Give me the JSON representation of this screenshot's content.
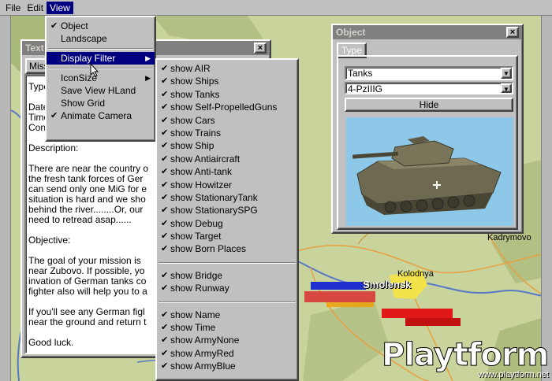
{
  "menubar": {
    "items": [
      "File",
      "Edit",
      "View"
    ]
  },
  "view_menu": {
    "items": [
      {
        "label": "Object",
        "checked": true
      },
      {
        "label": "Landscape",
        "checked": false
      },
      {
        "label": "Display Filter",
        "submenu": true,
        "highlighted": true
      },
      {
        "label": "IconSize",
        "submenu": true
      },
      {
        "label": "Save View HLand"
      },
      {
        "label": "Show Grid"
      },
      {
        "label": "Animate Camera",
        "checked": true
      }
    ]
  },
  "filter_menu": {
    "group1": [
      "show AIR",
      "show Ships",
      "show Tanks",
      "show Self-PropelledGuns",
      "show Cars",
      "show Trains",
      "show Ship",
      "show Antiaircraft",
      "show Anti-tank",
      "show Howitzer",
      "show StationaryTank",
      "show StationarySPG",
      "show Debug",
      "show Target",
      "show Born Places"
    ],
    "group2": [
      "show Bridge",
      "show Runway"
    ],
    "group3": [
      "show Name",
      "show Time",
      "show ArmyNone",
      "show ArmyRed",
      "show ArmyBlue"
    ]
  },
  "text_window": {
    "title": "Text",
    "tab": "Missi",
    "lines_header": [
      "Type",
      "Date",
      "Time",
      "Conc"
    ],
    "description_label": "Description:",
    "description": [
      "There are near the country o",
      "the fresh tank forces of Ger",
      "can send only one MiG for e",
      "situation is hard and we sho",
      "behind the river........Or, our",
      "need to retread asap......"
    ],
    "objective_label": "Objective:",
    "objective": [
      "The goal of your mission is",
      "near Zubovo. If possible, yo",
      "invation of German tanks co",
      "fighter also will help you to a"
    ],
    "extra": [
      "If you'll see any German figl",
      "near the ground and return t"
    ],
    "closing": "Good luck."
  },
  "object_window": {
    "title": "Object",
    "tab": "Type",
    "category": "Tanks",
    "model": "4-PzIIIG",
    "hide_label": "Hide"
  },
  "map_labels": {
    "kadrymovo": "Kadrymovo",
    "kolodnya": "Kolodnya",
    "smolensk": "Smolensk"
  },
  "watermark": {
    "logo": "Playtform",
    "url": "www.playtform.net"
  },
  "colors": {
    "menu_highlight": "#000080",
    "map_land": "#c9d39c",
    "road": "#e8a040",
    "river": "#5a78c8",
    "tank_bg": "#8ec8e8"
  }
}
